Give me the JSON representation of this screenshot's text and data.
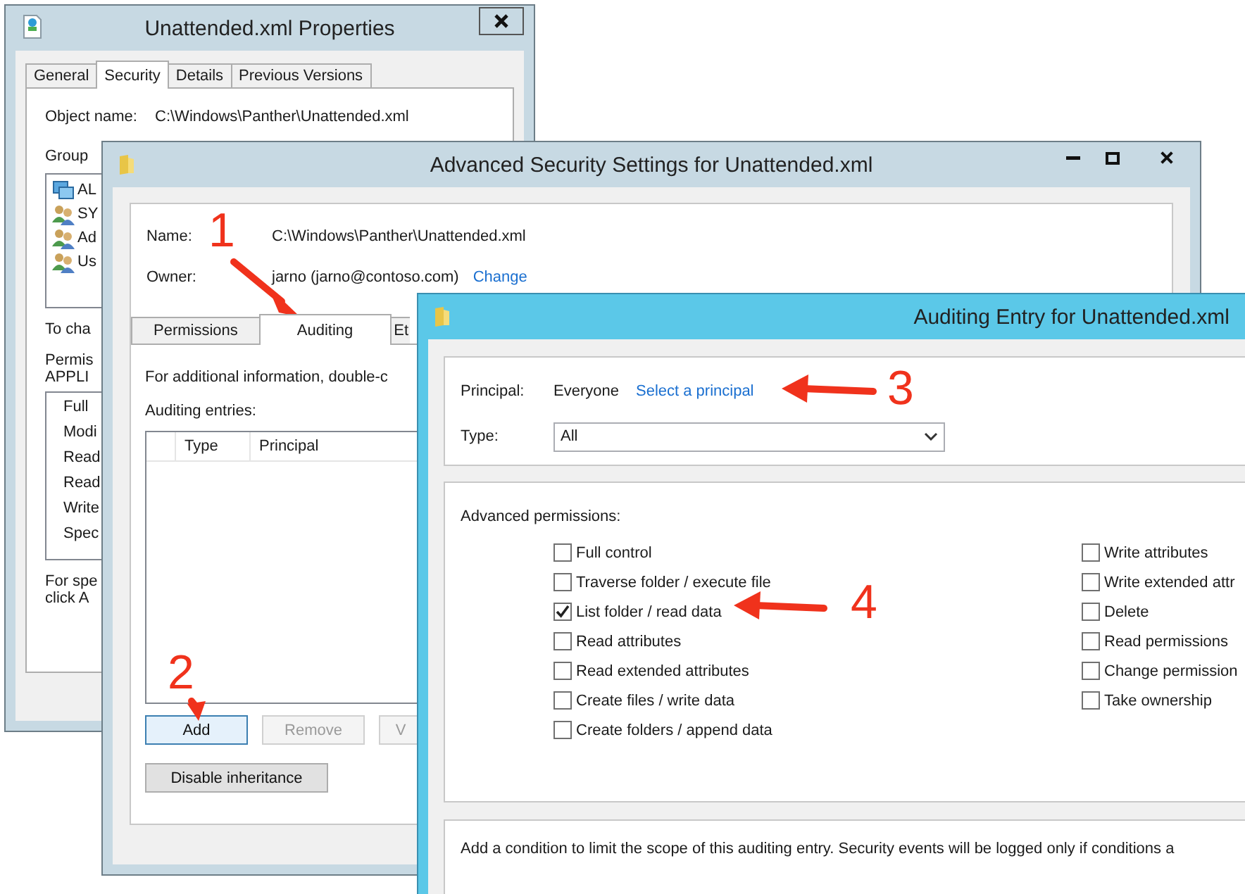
{
  "properties_window": {
    "title": "Unattended.xml Properties",
    "tabs": [
      {
        "label": "General",
        "selected": false
      },
      {
        "label": "Security",
        "selected": true
      },
      {
        "label": "Details",
        "selected": false
      },
      {
        "label": "Previous Versions",
        "selected": false
      }
    ],
    "object_name_label": "Object name:",
    "object_name": "C:\\Windows\\Panther\\Unattended.xml",
    "group_label": "Group",
    "groups": [
      {
        "label": "AL",
        "kind": "app"
      },
      {
        "label": "SY",
        "kind": "group"
      },
      {
        "label": "Ad",
        "kind": "group"
      },
      {
        "label": "Us",
        "kind": "group"
      }
    ],
    "change_text": "To cha",
    "permissions_label": "Permis",
    "permissions_for": "APPLI",
    "permissions": [
      "Full",
      "Modi",
      "Read",
      "Read",
      "Write",
      "Spec"
    ],
    "footer_lines": [
      "For spe",
      "click A"
    ]
  },
  "advanced_window": {
    "title": "Advanced Security Settings for Unattended.xml",
    "name_label": "Name:",
    "name": "C:\\Windows\\Panther\\Unattended.xml",
    "owner_label": "Owner:",
    "owner": "jarno (jarno@contoso.com)",
    "change_link": "Change",
    "tabs": [
      {
        "label": "Permissions",
        "selected": false
      },
      {
        "label": "Auditing",
        "selected": true
      },
      {
        "label": "Et",
        "selected": false
      }
    ],
    "info": "For additional information, double-c",
    "entries_label": "Auditing entries:",
    "columns": [
      "Type",
      "Principal"
    ],
    "buttons": [
      {
        "label": "Add",
        "disabled": false
      },
      {
        "label": "Remove",
        "disabled": true
      },
      {
        "label": "V",
        "disabled": true
      }
    ],
    "disable_inheritance": "Disable inheritance"
  },
  "auditing_entry_window": {
    "title": "Auditing Entry for Unattended.xml",
    "principal_label": "Principal:",
    "principal": "Everyone",
    "select_link": "Select a principal",
    "type_label": "Type:",
    "type_value": "All",
    "advanced_label": "Advanced permissions:",
    "permissions_left": [
      {
        "label": "Full control",
        "checked": false
      },
      {
        "label": "Traverse folder / execute file",
        "checked": false
      },
      {
        "label": "List folder / read data",
        "checked": true
      },
      {
        "label": "Read attributes",
        "checked": false
      },
      {
        "label": "Read extended attributes",
        "checked": false
      },
      {
        "label": "Create files / write data",
        "checked": false
      },
      {
        "label": "Create folders / append data",
        "checked": false
      }
    ],
    "permissions_right": [
      {
        "label": "Write attributes",
        "checked": false
      },
      {
        "label": "Write extended attr",
        "checked": false
      },
      {
        "label": "Delete",
        "checked": false
      },
      {
        "label": "Read permissions",
        "checked": false
      },
      {
        "label": "Change permission",
        "checked": false
      },
      {
        "label": "Take ownership",
        "checked": false
      }
    ],
    "condition_text": "Add a condition to limit the scope of this auditing entry. Security events will be logged only if conditions a"
  },
  "annotations": [
    {
      "label": "1"
    },
    {
      "label": "2"
    },
    {
      "label": "3"
    },
    {
      "label": "4"
    }
  ]
}
